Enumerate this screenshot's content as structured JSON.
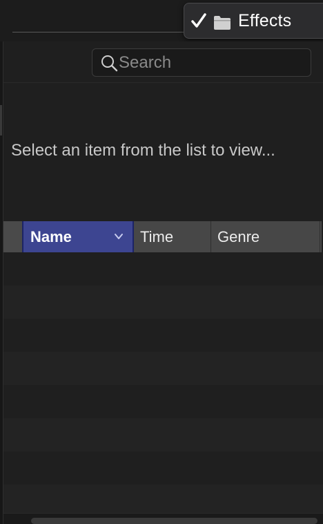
{
  "menu": {
    "items": [
      {
        "label": "Effects",
        "checked": true,
        "icon": "folder-icon"
      }
    ]
  },
  "search": {
    "placeholder": "Search",
    "value": ""
  },
  "preview": {
    "message": "Select an item from the list to view..."
  },
  "table": {
    "columns": [
      {
        "label": "Name",
        "sorted": true,
        "sort_icon": "chevron-down-icon"
      },
      {
        "label": "Time"
      },
      {
        "label": "Genre"
      }
    ],
    "rows": []
  },
  "colors": {
    "selected_column": "#3d4591",
    "background": "#1f1f1f",
    "header": "#474747"
  }
}
